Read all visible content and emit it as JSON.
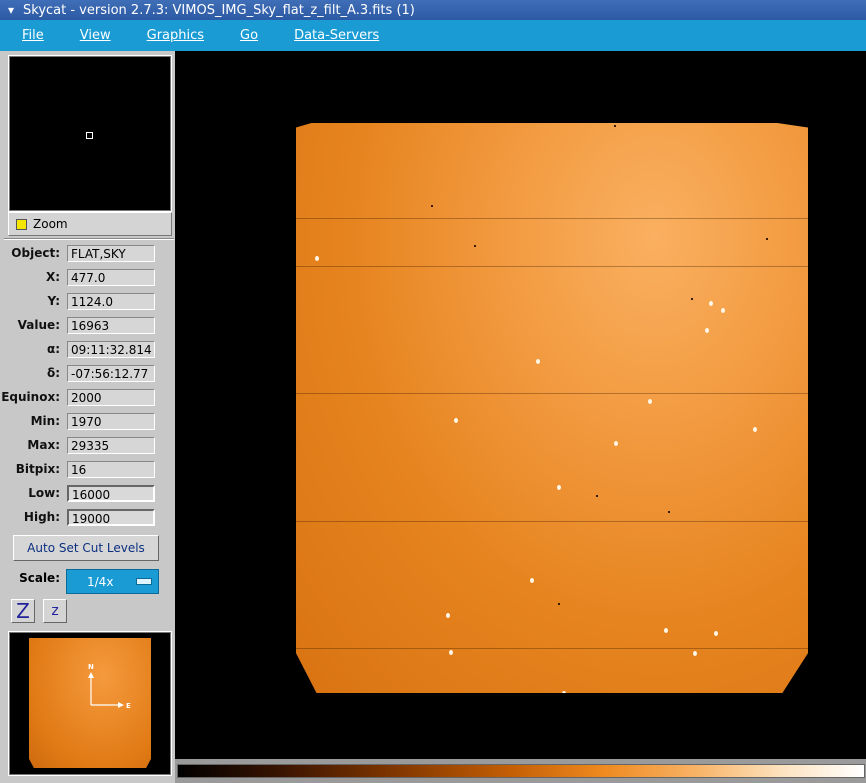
{
  "window": {
    "title": "Skycat - version 2.7.3: VIMOS_IMG_Sky_flat_z_filt_A.3.fits (1)"
  },
  "menu": [
    "File",
    "View",
    "Graphics",
    "Go",
    "Data-Servers"
  ],
  "zoom": {
    "label": "Zoom"
  },
  "info_panel": {
    "fields": [
      {
        "label": "Object:",
        "value": "FLAT,SKY"
      },
      {
        "label": "X:",
        "value": "477.0"
      },
      {
        "label": "Y:",
        "value": "1124.0"
      },
      {
        "label": "Value:",
        "value": "16963"
      },
      {
        "label": "α:",
        "value": "09:11:32.814"
      },
      {
        "label": "δ:",
        "value": "-07:56:12.77"
      },
      {
        "label": "Equinox:",
        "value": "2000"
      },
      {
        "label": "Min:",
        "value": "1970"
      },
      {
        "label": "Max:",
        "value": "29335"
      },
      {
        "label": "Bitpix:",
        "value": "16"
      },
      {
        "label": "Low:",
        "value": "16000"
      },
      {
        "label": "High:",
        "value": "19000"
      }
    ],
    "auto_cut_label": "Auto Set Cut Levels",
    "scale_label": "Scale:",
    "scale_value": "1/4x",
    "zoom_in_label": "Z",
    "zoom_out_label": "z"
  },
  "compass": {
    "north": "N",
    "east": "E"
  },
  "colors": {
    "menu_bg": "#1a9bd4",
    "image_orange": "#e6841f",
    "link_blue": "#0b2f80"
  }
}
